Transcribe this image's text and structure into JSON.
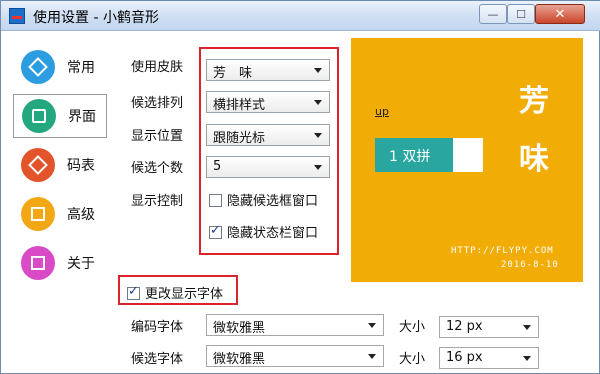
{
  "window": {
    "title": "使用设置 - 小鹤音形",
    "controls": {
      "minimize": "—",
      "maximize": "☐",
      "close": "✕"
    }
  },
  "sidebar": {
    "items": [
      {
        "label": "常用",
        "icon": "common-icon",
        "color": "#2b9de0"
      },
      {
        "label": "界面",
        "icon": "interface-icon",
        "color": "#23a77e",
        "active": true
      },
      {
        "label": "码表",
        "icon": "codetable-icon",
        "color": "#e3542a"
      },
      {
        "label": "高级",
        "icon": "advanced-icon",
        "color": "#f1a814"
      },
      {
        "label": "关于",
        "icon": "about-icon",
        "color": "#d94ac6"
      }
    ]
  },
  "settings": {
    "skin": {
      "label": "使用皮肤",
      "value": "芳　味"
    },
    "arrangement": {
      "label": "候选排列",
      "value": "横排样式"
    },
    "position": {
      "label": "显示位置",
      "value": "跟随光标"
    },
    "count": {
      "label": "候选个数",
      "value": "5"
    },
    "display_control": {
      "label": "显示控制",
      "hide_candidate_window": {
        "label": "隐藏候选框窗口",
        "checked": false
      },
      "hide_status_window": {
        "label": "隐藏状态栏窗口",
        "checked": true
      }
    },
    "change_font": {
      "label": "更改显示字体",
      "checked": true
    },
    "code_font": {
      "label": "编码字体",
      "value": "微软雅黑",
      "size_label": "大小",
      "size": "12 px"
    },
    "candidate_font": {
      "label": "候选字体",
      "value": "微软雅黑",
      "size_label": "大小",
      "size": "16 px"
    }
  },
  "preview": {
    "background": "#f2ac06",
    "code": "up",
    "candidate": "1 双拼",
    "char_top": "芳",
    "char_bottom": "味",
    "url": "HTTP://FLYPY.COM",
    "date": "2016-8-10"
  },
  "accent_red": "#d9242b"
}
